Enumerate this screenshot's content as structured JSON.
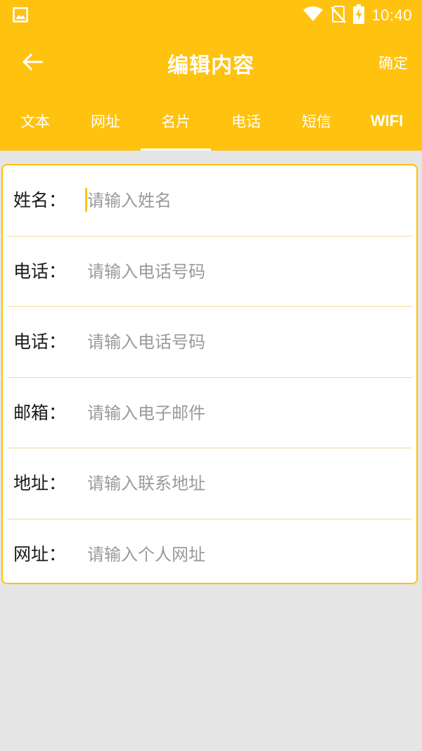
{
  "status_bar": {
    "time": "10:40",
    "icons": [
      "image-icon",
      "wifi-icon",
      "no-sim-icon",
      "battery-charging-icon"
    ]
  },
  "app_bar": {
    "title": "编辑内容",
    "confirm_label": "确定",
    "back_icon": "arrow-left-icon"
  },
  "tabs": [
    {
      "label": "文本"
    },
    {
      "label": "网址"
    },
    {
      "label": "名片"
    },
    {
      "label": "电话"
    },
    {
      "label": "短信"
    },
    {
      "label": "WIFI"
    }
  ],
  "active_tab": "名片",
  "form": {
    "rows": [
      {
        "label": "姓名：",
        "placeholder": "请输入姓名",
        "value": ""
      },
      {
        "label": "电话：",
        "placeholder": "请输入电话号码",
        "value": ""
      },
      {
        "label": "电话：",
        "placeholder": "请输入电话号码",
        "value": ""
      },
      {
        "label": "邮箱：",
        "placeholder": "请输入电子邮件",
        "value": ""
      },
      {
        "label": "地址：",
        "placeholder": "请输入联系地址",
        "value": ""
      },
      {
        "label": "网址：",
        "placeholder": "请输入个人网址",
        "value": ""
      }
    ]
  },
  "colors": {
    "accent": "#FFC20E",
    "background": "#E5E5E5",
    "divider": "#F3DD99",
    "placeholder": "#9A9A9A"
  }
}
